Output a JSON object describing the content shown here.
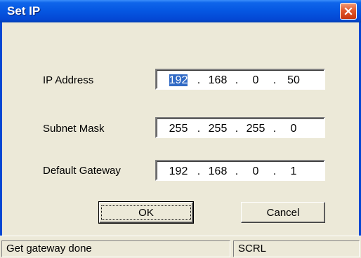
{
  "window": {
    "title": "Set IP"
  },
  "fields": [
    {
      "label": "IP Address",
      "octets": [
        "192",
        "168",
        "0",
        "50"
      ]
    },
    {
      "label": "Subnet Mask",
      "octets": [
        "255",
        "255",
        "255",
        "0"
      ]
    },
    {
      "label": "Default Gateway",
      "octets": [
        "192",
        "168",
        "0",
        "1"
      ]
    }
  ],
  "separator": ".",
  "buttons": {
    "ok": "OK",
    "cancel": "Cancel"
  },
  "statusbar": {
    "message": "Get gateway done",
    "indicator": "SCRL"
  },
  "icons": {
    "close": "close-icon"
  },
  "colors": {
    "titlebar": "#0556e1",
    "close_button": "#e2582b",
    "selection": "#316ac5",
    "face": "#ece9d8"
  }
}
